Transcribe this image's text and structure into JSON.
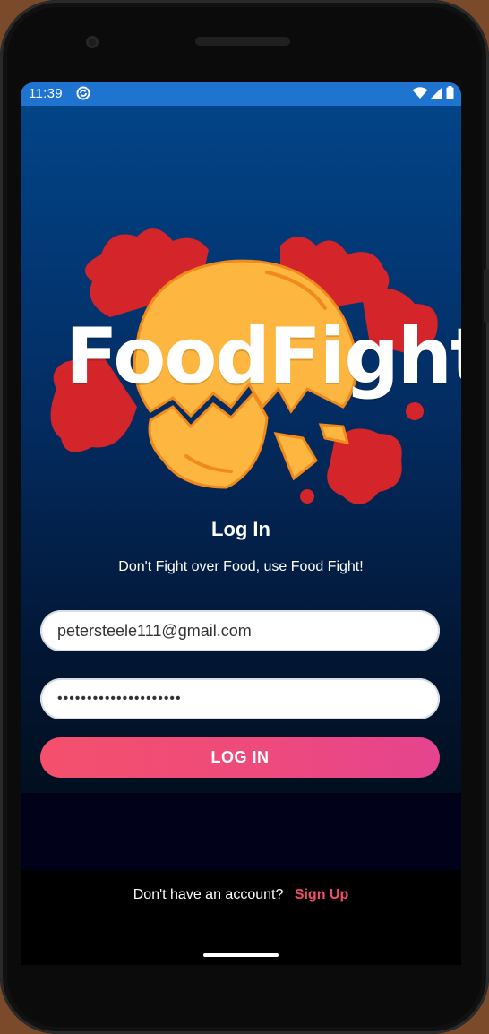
{
  "status_bar": {
    "time": "11:39",
    "icons": [
      "sync-icon",
      "wifi-icon",
      "signal-icon",
      "battery-icon"
    ]
  },
  "app": {
    "logo_text": "FoodFight",
    "title": "Log In",
    "tagline": "Don't Fight over Food, use Food Fight!"
  },
  "form": {
    "email_value": "petersteele111@gmail.com",
    "password_value": "•••••••••••••••••••••",
    "login_label": "LOG IN"
  },
  "footer": {
    "prompt": "Don't have an account?",
    "signup_label": "Sign Up"
  },
  "colors": {
    "status_bar": "#1f74d0",
    "accent": "#f24d67",
    "splash_red": "#d3252a",
    "pizza_yellow": "#fdb740"
  }
}
